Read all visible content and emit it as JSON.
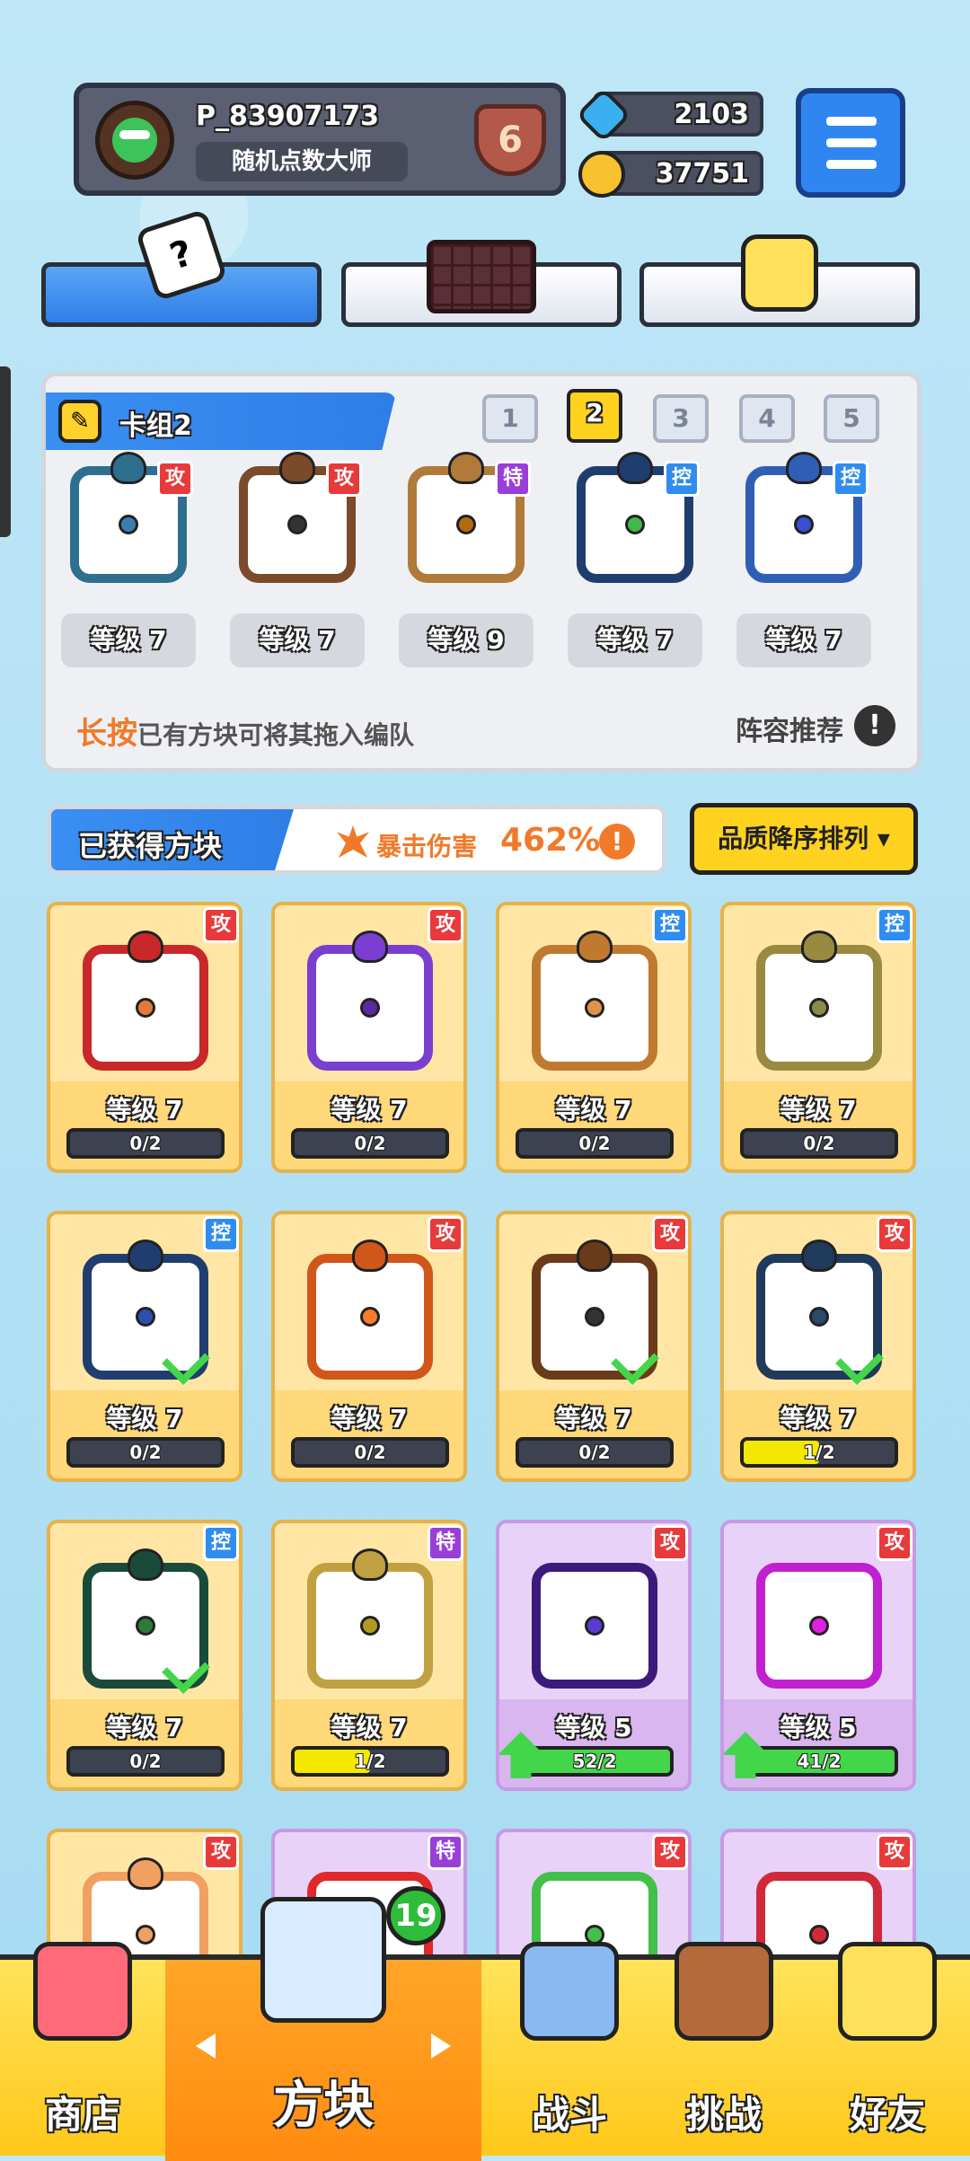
{
  "header": {
    "username": "P_83907173",
    "title": "随机点数大师",
    "rank": "6",
    "gems": "2103",
    "coins": "37751"
  },
  "tabs": [
    {
      "name": "dice",
      "icon": "dice-icon"
    },
    {
      "name": "board",
      "icon": "board-icon"
    },
    {
      "name": "emoji",
      "icon": "emoji-icon"
    }
  ],
  "deck": {
    "name": "卡组2",
    "numbers": [
      "1",
      "2",
      "3",
      "4",
      "5"
    ],
    "active": 2,
    "slots": [
      {
        "type": "攻",
        "level": "等级 7",
        "color": "#2e6f8f",
        "dot": "#3a7fb0"
      },
      {
        "type": "攻",
        "level": "等级 7",
        "color": "#7a4a2a",
        "dot": "#333333"
      },
      {
        "type": "特",
        "level": "等级 9",
        "color": "#b07a3a",
        "dot": "#b56a10"
      },
      {
        "type": "控",
        "level": "等级 7",
        "color": "#1f3e6f",
        "dot": "#42b84a"
      },
      {
        "type": "控",
        "level": "等级 7",
        "color": "#2f5fb5",
        "dot": "#3a4fd0"
      }
    ],
    "hint_highlight": "长按",
    "hint_text": "已有方块可将其拖入编队",
    "recommend": "阵容推荐",
    "recommend_icon": "!"
  },
  "collection": {
    "title": "已获得方块",
    "crit_label": "暴击伤害",
    "crit_value": "462%",
    "info_icon": "!",
    "sort_label": "品质降序排列 ▾",
    "cards": [
      {
        "type": "攻",
        "level": "等级 7",
        "progress": "0/2",
        "fill": 0,
        "frame": "#c8282a",
        "dot": "#e37a3a",
        "style": "gold",
        "check": false
      },
      {
        "type": "攻",
        "level": "等级 7",
        "progress": "0/2",
        "fill": 0,
        "frame": "#7a3ed0",
        "dot": "#5a2aa0",
        "style": "gold",
        "check": false
      },
      {
        "type": "控",
        "level": "等级 7",
        "progress": "0/2",
        "fill": 0,
        "frame": "#c07a30",
        "dot": "#e0924a",
        "style": "gold",
        "check": false
      },
      {
        "type": "控",
        "level": "等级 7",
        "progress": "0/2",
        "fill": 0,
        "frame": "#9a8a40",
        "dot": "#8a8a4a",
        "style": "gold",
        "check": false
      },
      {
        "type": "控",
        "level": "等级 7",
        "progress": "0/2",
        "fill": 0,
        "frame": "#1f3e6f",
        "dot": "#2f4fb0",
        "style": "gold",
        "check": true
      },
      {
        "type": "攻",
        "level": "等级 7",
        "progress": "0/2",
        "fill": 0,
        "frame": "#d0561a",
        "dot": "#ff7a2a",
        "style": "gold",
        "check": false
      },
      {
        "type": "攻",
        "level": "等级 7",
        "progress": "0/2",
        "fill": 0,
        "frame": "#6a3a1a",
        "dot": "#333333",
        "style": "gold",
        "check": true
      },
      {
        "type": "攻",
        "level": "等级 7",
        "progress": "1/2",
        "fill": 0.5,
        "frame": "#1f3a5a",
        "dot": "#2a4a6a",
        "style": "gold",
        "check": true
      },
      {
        "type": "控",
        "level": "等级 7",
        "progress": "0/2",
        "fill": 0,
        "frame": "#1a4a3a",
        "dot": "#2e7a3a",
        "style": "gold",
        "check": true
      },
      {
        "type": "特",
        "level": "等级 7",
        "progress": "1/2",
        "fill": 0.5,
        "frame": "#c0a040",
        "dot": "#b09a20",
        "style": "gold",
        "check": false
      },
      {
        "type": "攻",
        "level": "等级 5",
        "progress": "52/2",
        "fill": 1,
        "frame": "#3a1a7a",
        "dot": "#5a3ad0",
        "style": "purple",
        "check": false
      },
      {
        "type": "攻",
        "level": "等级 5",
        "progress": "41/2",
        "fill": 1,
        "frame": "#c020d0",
        "dot": "#e020e0",
        "style": "purple",
        "check": false
      },
      {
        "type": "攻",
        "level": "",
        "progress": "",
        "fill": 0,
        "frame": "#f0a060",
        "dot": "#f0a060",
        "style": "gold",
        "check": false
      },
      {
        "type": "特",
        "level": "",
        "progress": "",
        "fill": 0,
        "frame": "#e02a2a",
        "dot": "#e02a2a",
        "style": "purple",
        "check": false
      },
      {
        "type": "攻",
        "level": "",
        "progress": "",
        "fill": 0,
        "frame": "#43c04a",
        "dot": "#43c04a",
        "style": "purple",
        "check": false
      },
      {
        "type": "攻",
        "level": "",
        "progress": "",
        "fill": 0,
        "frame": "#d02a3a",
        "dot": "#d02a3a",
        "style": "purple",
        "check": false
      }
    ]
  },
  "nav": {
    "shop": "商店",
    "blocks": "方块",
    "battle": "战斗",
    "challenge": "挑战",
    "friends": "好友",
    "badge": "19"
  },
  "colors": {
    "accent_blue": "#2f86f0",
    "gold": "#ffd21f",
    "orange": "#f07a2a"
  }
}
